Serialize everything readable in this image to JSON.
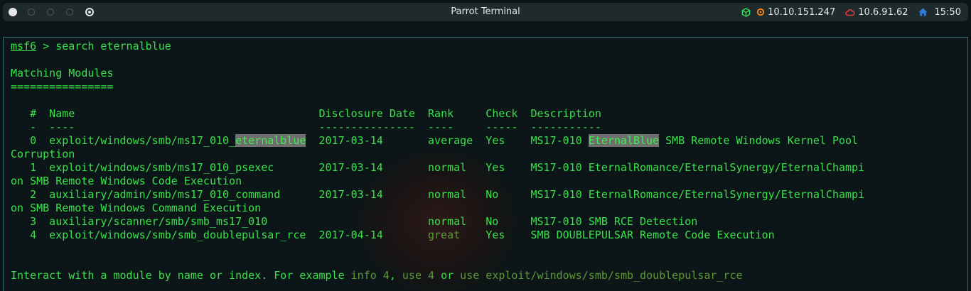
{
  "window": {
    "title": "Parrot Terminal"
  },
  "panel": {
    "ip_local": "10.10.151.247",
    "ip_vpn": "10.6.91.62",
    "time": "15:50",
    "colors": {
      "cube": "#3adb5a",
      "target": "#ff8a1e",
      "vpn": "#e53935",
      "home": "#2f7bd6"
    }
  },
  "terminal": {
    "prompt": "msf6",
    "prompt_sep": " > ",
    "command": "search eternalblue",
    "section_title": "Matching Modules",
    "section_rule": "================",
    "header": {
      "num": "   #",
      "name": "  Name                                      ",
      "date": "Disclosure Date",
      "rank": "Rank",
      "check": "Check",
      "desc": "Description"
    },
    "dash_line": "   -  ----                                      ---------------  ----     -----  -----------",
    "row0": {
      "a": "   0  exploit/windows/smb/ms17_010_",
      "hl1": "eternalblue",
      "b": "  2017-03-14       average  Yes    MS17-010 ",
      "hl2": "EternalBlue",
      "c": " SMB Remote Windows Kernel Pool",
      "wrap": "Corruption"
    },
    "row1": {
      "line": "   1  exploit/windows/smb/ms17_010_psexec       2017-03-14       normal   Yes    MS17-010 EternalRomance/EternalSynergy/EternalChampi",
      "wrap": "on SMB Remote Windows Code Execution"
    },
    "row2": {
      "line": "   2  auxiliary/admin/smb/ms17_010_command      2017-03-14       normal   No     MS17-010 EternalRomance/EternalSynergy/EternalChampi",
      "wrap": "on SMB Remote Windows Command Execution"
    },
    "row3": {
      "line": "   3  auxiliary/scanner/smb/smb_ms17_010                         normal   No     MS17-010 SMB RCE Detection"
    },
    "row4": {
      "a": "   4  exploit/windows/smb/smb_doublepulsar_rce  2017-04-14       ",
      "rank": "great",
      "b": "    Yes    SMB DOUBLEPULSAR Remote Code Execution"
    },
    "footer": {
      "a": "Interact with a module by name or index. For example ",
      "ex1": "info 4",
      "comma": ", ",
      "ex2": "use 4",
      "or": " or ",
      "ex3": "use exploit/windows/smb/smb_doublepulsar_rce"
    }
  }
}
